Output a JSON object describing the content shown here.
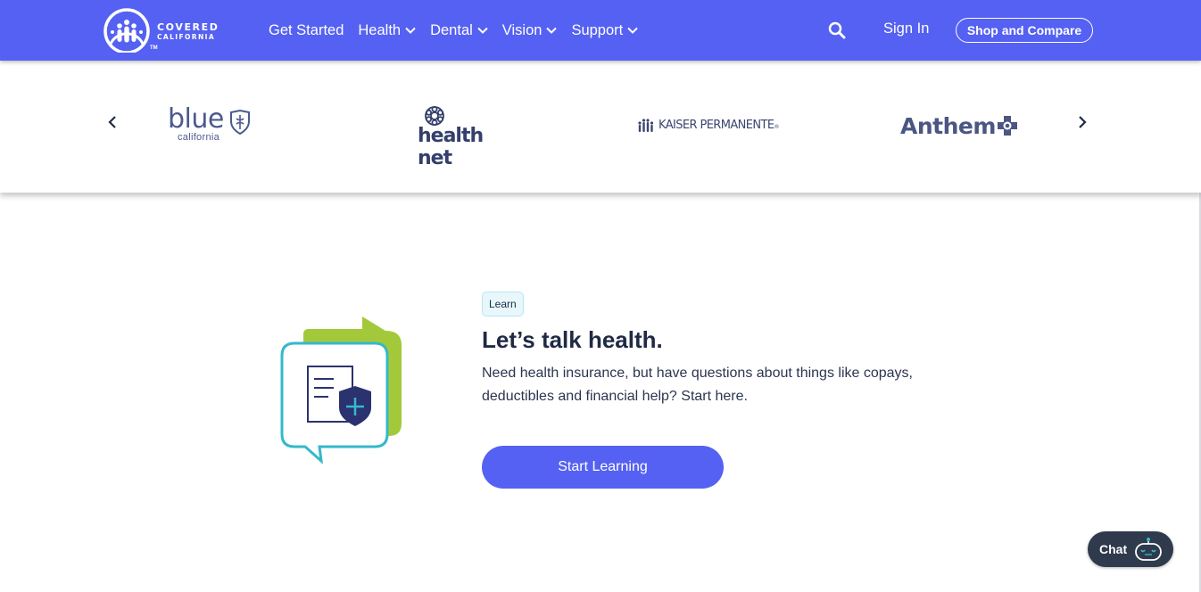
{
  "header": {
    "logo": {
      "line1": "COVERED",
      "line2": "CALIFORNIA",
      "tm": "TM",
      "icon": "covered-california-logo"
    },
    "nav": [
      {
        "label": "Get Started",
        "has_dropdown": false
      },
      {
        "label": "Health",
        "has_dropdown": true
      },
      {
        "label": "Dental",
        "has_dropdown": true
      },
      {
        "label": "Vision",
        "has_dropdown": true
      },
      {
        "label": "Support",
        "has_dropdown": true
      }
    ],
    "search_icon": "search-icon",
    "sign_in": "Sign In",
    "cta": "Shop and Compare",
    "bg_color": "#5561f2"
  },
  "carousel": {
    "prev_icon": "chevron-left-icon",
    "next_icon": "chevron-right-icon",
    "carriers": {
      "blue": {
        "word": "blue",
        "sub": "california"
      },
      "healthnet": {
        "word": "health net"
      },
      "kaiser": {
        "word": "KAISER PERMANENTE",
        "reg": "®"
      },
      "anthem": {
        "word": "Anthem"
      }
    }
  },
  "learn": {
    "tag": "Learn",
    "heading": "Let’s talk health.",
    "description": "Need health insurance, but have questions about things like copays, deductibles and financial help? Start here.",
    "button": "Start Learning",
    "illustration": "chat-bubble-document-shield-icon"
  },
  "chat": {
    "label": "Chat",
    "icon": "chatbot-icon"
  },
  "colors": {
    "accent": "#5561f2",
    "text_dark": "#1f2a44",
    "green": "#a3c93a",
    "teal": "#34b9cc",
    "navy": "#2b3270"
  }
}
